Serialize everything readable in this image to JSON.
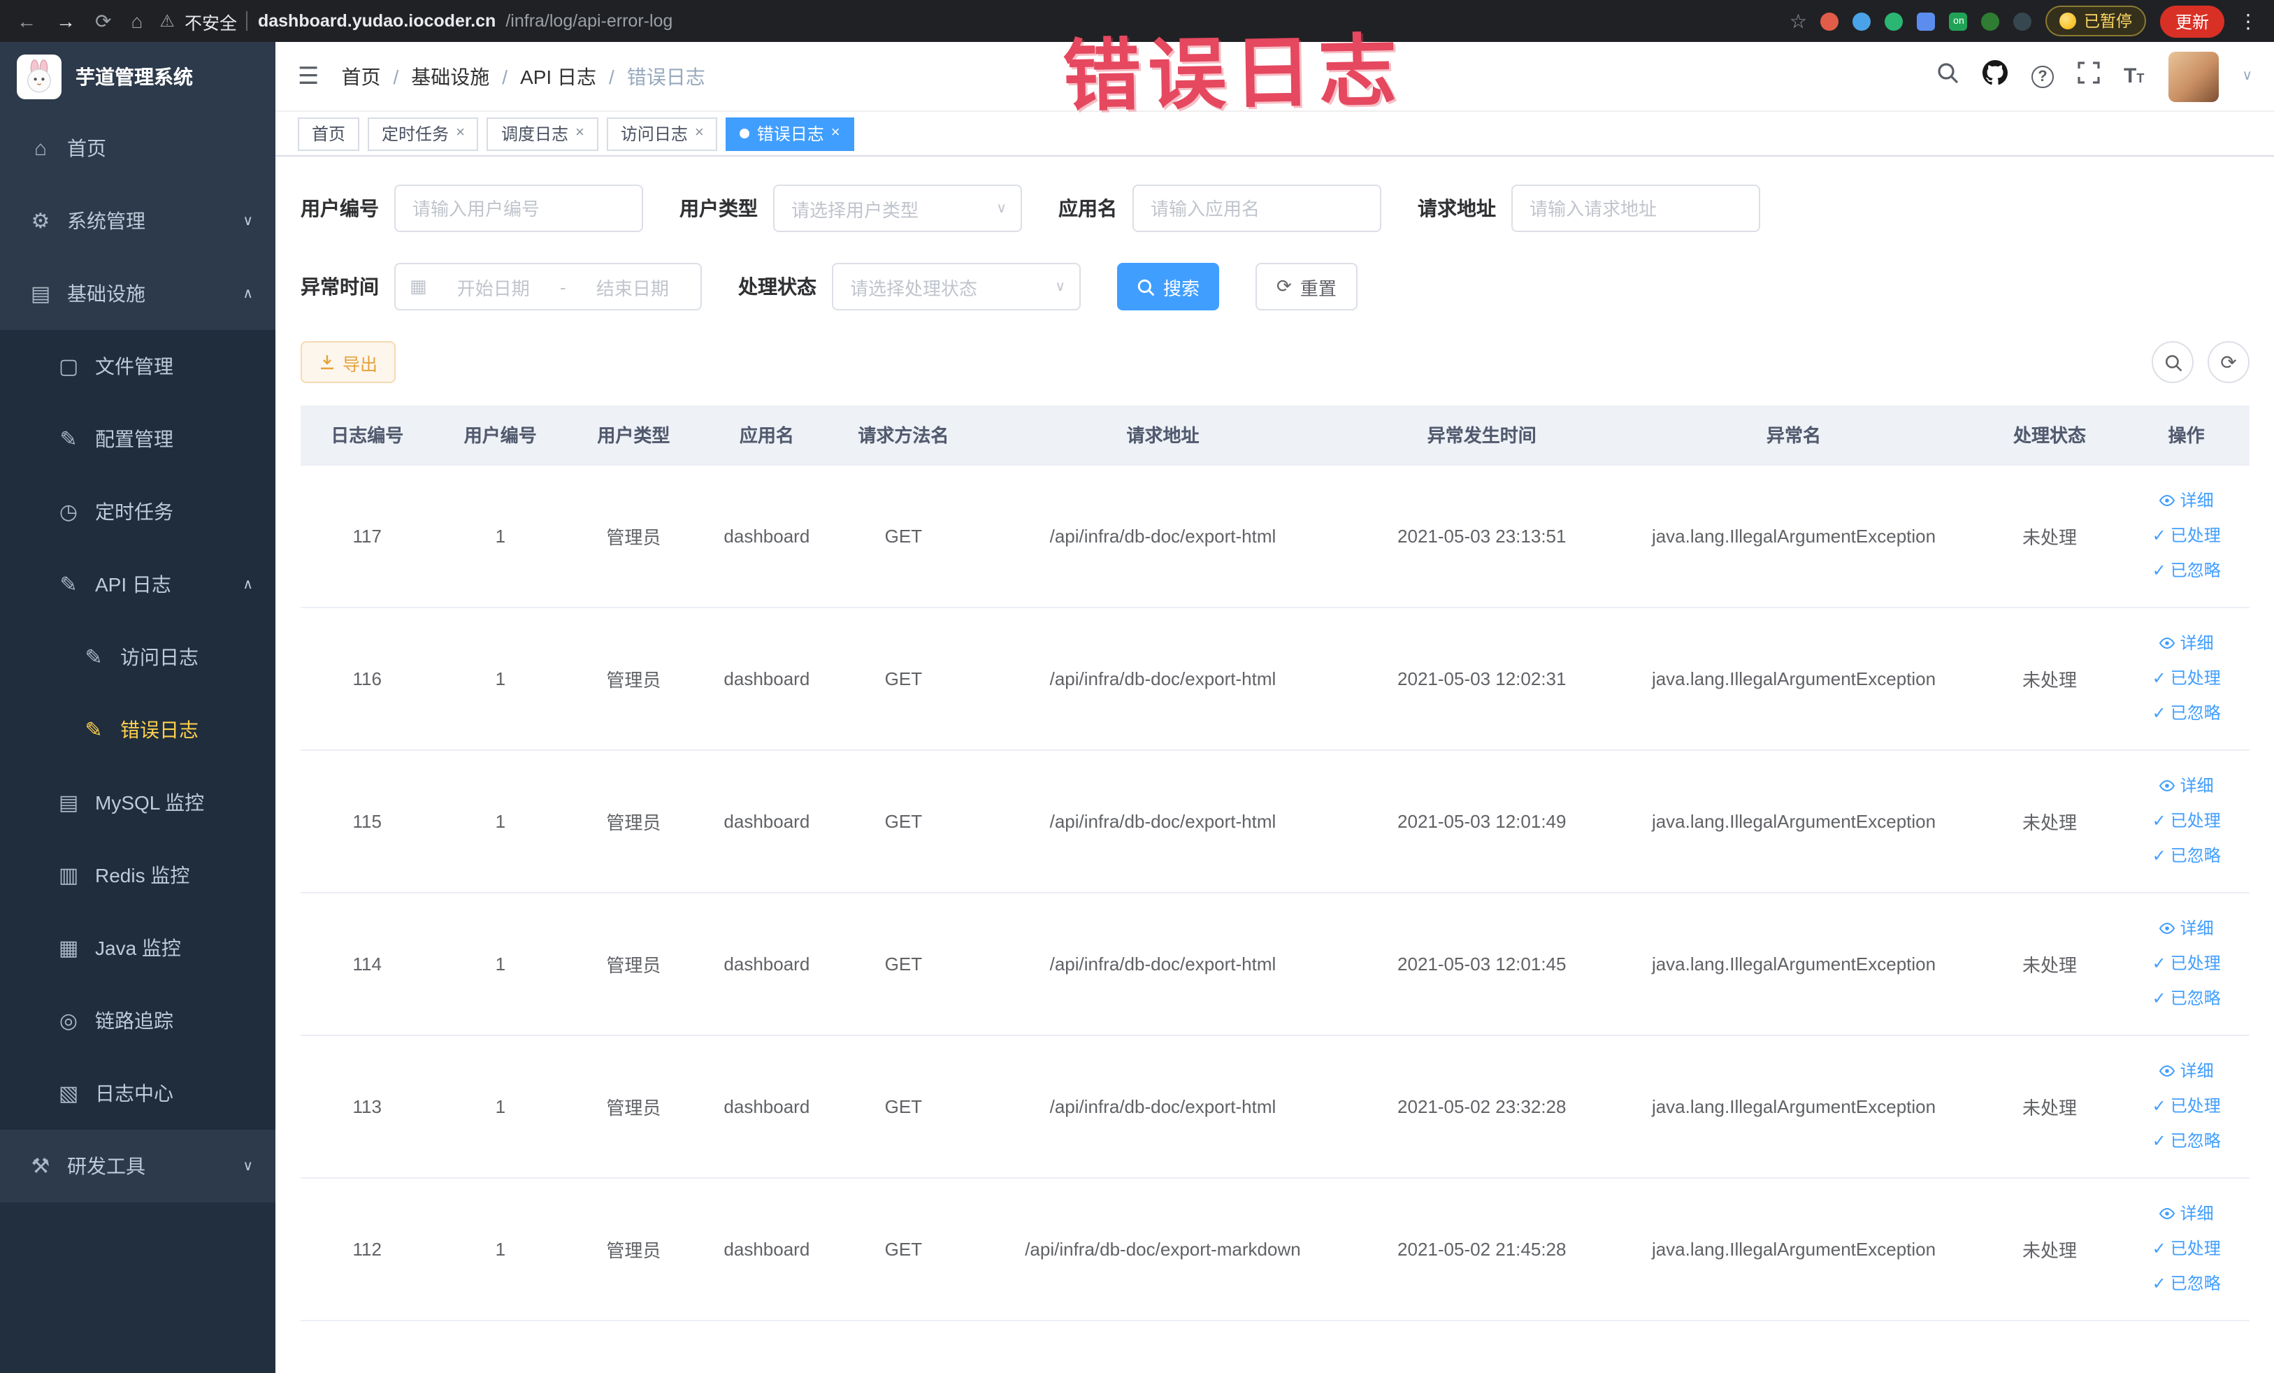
{
  "browser": {
    "security_label": "不安全",
    "url_host": "dashboard.yudao.iocoder.cn",
    "url_path": "/infra/log/api-error-log",
    "paused_badge": "已暂停",
    "update_button": "更新"
  },
  "annotation": {
    "text": "错误日志"
  },
  "icons": {
    "back": "←",
    "forward": "→",
    "reload": "⟳",
    "home": "⌂",
    "warning": "⚠",
    "star": "☆",
    "more": "⋮",
    "hamburger": "☰",
    "chevron_down": "∨",
    "chevron_up": "∧",
    "close": "×",
    "caret_down": "▾",
    "check": "✓",
    "calendar": "▦",
    "refresh": "⟳",
    "question": "?",
    "text_size_big": "T",
    "text_size_small": "T",
    "ext_on_label": "on",
    "menu": {
      "home": "⌂",
      "system": "⚙",
      "infra": "▤",
      "file": "▢",
      "config": "✎",
      "job": "◷",
      "api_log": "✎",
      "access_log": "✎",
      "error_log": "✎",
      "mysql": "▤",
      "redis": "▥",
      "java": "▦",
      "trace": "◎",
      "log_center": "▧",
      "tools": "⚒"
    }
  },
  "sidebar": {
    "title": "芋道管理系统",
    "items": [
      {
        "label": "首页"
      },
      {
        "label": "系统管理"
      },
      {
        "label": "基础设施"
      },
      {
        "label": "文件管理"
      },
      {
        "label": "配置管理"
      },
      {
        "label": "定时任务"
      },
      {
        "label": "API 日志"
      },
      {
        "label": "访问日志"
      },
      {
        "label": "错误日志"
      },
      {
        "label": "MySQL 监控"
      },
      {
        "label": "Redis 监控"
      },
      {
        "label": "Java 监控"
      },
      {
        "label": "链路追踪"
      },
      {
        "label": "日志中心"
      },
      {
        "label": "研发工具"
      }
    ]
  },
  "breadcrumb": {
    "separator": "/",
    "items": [
      "首页",
      "基础设施",
      "API 日志",
      "错误日志"
    ]
  },
  "tabs": [
    {
      "label": "首页"
    },
    {
      "label": "定时任务"
    },
    {
      "label": "调度日志"
    },
    {
      "label": "访问日志"
    },
    {
      "label": "错误日志"
    }
  ],
  "filters": {
    "user_id": {
      "label": "用户编号",
      "placeholder": "请输入用户编号"
    },
    "user_type": {
      "label": "用户类型",
      "placeholder": "请选择用户类型"
    },
    "app_name": {
      "label": "应用名",
      "placeholder": "请输入应用名"
    },
    "request_url": {
      "label": "请求地址",
      "placeholder": "请输入请求地址"
    },
    "exception_time": {
      "label": "异常时间",
      "start_placeholder": "开始日期",
      "end_placeholder": "结束日期",
      "separator": "-"
    },
    "process_status": {
      "label": "处理状态",
      "placeholder": "请选择处理状态"
    },
    "search_button": "搜索",
    "reset_button": "重置"
  },
  "toolbar": {
    "export_button": "导出"
  },
  "table": {
    "columns": [
      "日志编号",
      "用户编号",
      "用户类型",
      "应用名",
      "请求方法名",
      "请求地址",
      "异常发生时间",
      "异常名",
      "处理状态",
      "操作"
    ],
    "row_actions": {
      "detail": "详细",
      "processed": "已处理",
      "ignored": "已忽略"
    },
    "rows": [
      {
        "id": "117",
        "user_id": "1",
        "user_type": "管理员",
        "app": "dashboard",
        "method": "GET",
        "url": "/api/infra/db-doc/export-html",
        "time": "2021-05-03 23:13:51",
        "exception": "java.lang.IllegalArgumentException",
        "status": "未处理"
      },
      {
        "id": "116",
        "user_id": "1",
        "user_type": "管理员",
        "app": "dashboard",
        "method": "GET",
        "url": "/api/infra/db-doc/export-html",
        "time": "2021-05-03 12:02:31",
        "exception": "java.lang.IllegalArgumentException",
        "status": "未处理"
      },
      {
        "id": "115",
        "user_id": "1",
        "user_type": "管理员",
        "app": "dashboard",
        "method": "GET",
        "url": "/api/infra/db-doc/export-html",
        "time": "2021-05-03 12:01:49",
        "exception": "java.lang.IllegalArgumentException",
        "status": "未处理"
      },
      {
        "id": "114",
        "user_id": "1",
        "user_type": "管理员",
        "app": "dashboard",
        "method": "GET",
        "url": "/api/infra/db-doc/export-html",
        "time": "2021-05-03 12:01:45",
        "exception": "java.lang.IllegalArgumentException",
        "status": "未处理"
      },
      {
        "id": "113",
        "user_id": "1",
        "user_type": "管理员",
        "app": "dashboard",
        "method": "GET",
        "url": "/api/infra/db-doc/export-html",
        "time": "2021-05-02 23:32:28",
        "exception": "java.lang.IllegalArgumentException",
        "status": "未处理"
      },
      {
        "id": "112",
        "user_id": "1",
        "user_type": "管理员",
        "app": "dashboard",
        "method": "GET",
        "url": "/api/infra/db-doc/export-markdown",
        "time": "2021-05-02 21:45:28",
        "exception": "java.lang.IllegalArgumentException",
        "status": "未处理"
      }
    ]
  }
}
